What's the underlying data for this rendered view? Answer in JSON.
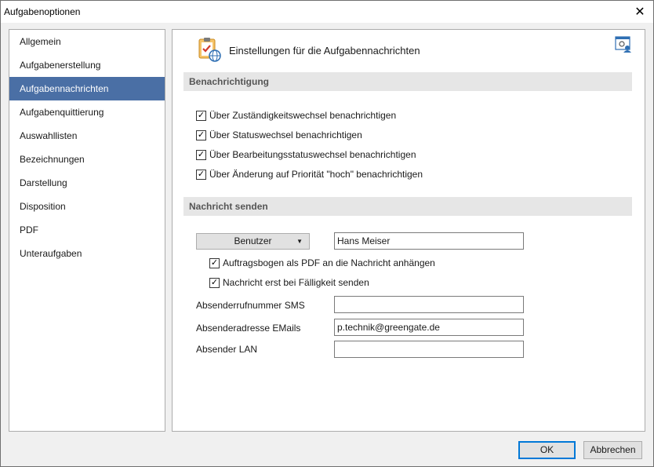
{
  "window": {
    "title": "Aufgabenoptionen",
    "close_glyph": "✕"
  },
  "sidebar": {
    "items": [
      {
        "label": "Allgemein"
      },
      {
        "label": "Aufgabenerstellung"
      },
      {
        "label": "Aufgabennachrichten",
        "active": true
      },
      {
        "label": "Aufgabenquittierung"
      },
      {
        "label": "Auswahllisten"
      },
      {
        "label": "Bezeichnungen"
      },
      {
        "label": "Darstellung"
      },
      {
        "label": "Disposition"
      },
      {
        "label": "PDF"
      },
      {
        "label": "Unteraufgaben"
      }
    ]
  },
  "header": {
    "title": "Einstellungen für die Aufgabennachrichten",
    "icon": "clipboard-globe-icon",
    "corner_icon": "settings-user-icon"
  },
  "notification": {
    "section_label": "Benachrichtigung",
    "options": [
      {
        "label": "Über Zuständigkeitswechsel benachrichtigen",
        "checked": true
      },
      {
        "label": "Über Statuswechsel  benachrichtigen",
        "checked": true
      },
      {
        "label": "Über Bearbeitungsstatuswechsel  benachrichtigen",
        "checked": true
      },
      {
        "label": "Über Änderung auf Priorität \"hoch\" benachrichtigen",
        "checked": true
      }
    ]
  },
  "send": {
    "section_label": "Nachricht senden",
    "recipient_type": "Benutzer",
    "recipient_value": "Hans Meiser",
    "options": [
      {
        "label": "Auftragsbogen als PDF an die Nachricht anhängen",
        "checked": true
      },
      {
        "label": "Nachricht erst bei Fälligkeit senden",
        "checked": true
      }
    ],
    "sms_label": "Absenderrufnummer SMS",
    "sms_value": "",
    "email_label": "Absenderadresse EMails",
    "email_value": "p.technik@greengate.de",
    "lan_label": "Absender LAN",
    "lan_value": ""
  },
  "footer": {
    "ok_label": "OK",
    "cancel_label": "Abbrechen"
  },
  "colors": {
    "accent": "#4a6fa5",
    "focus_border": "#0078d7"
  },
  "check_glyph": "✓"
}
